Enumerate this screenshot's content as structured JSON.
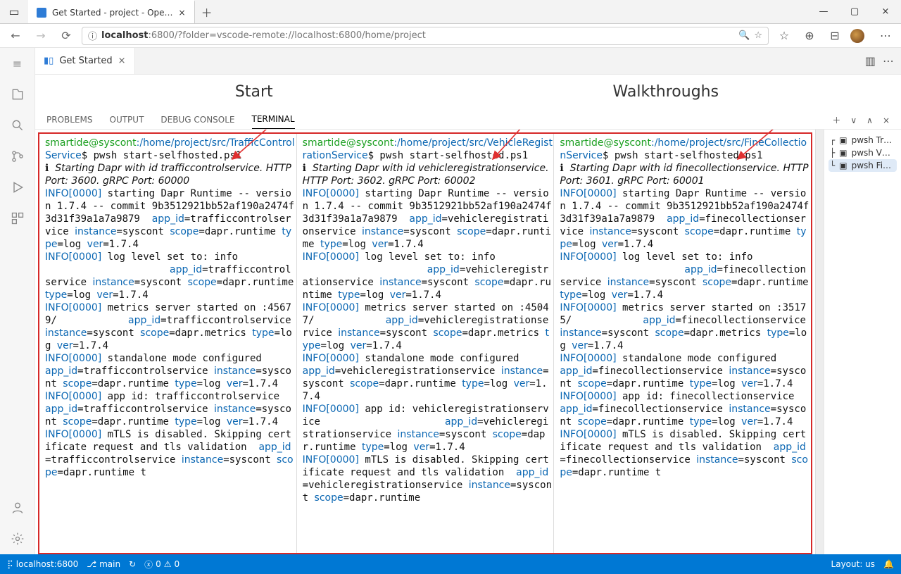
{
  "browser": {
    "tab_title": "Get Started - project - Ope…",
    "url_host": "localhost",
    "url_path": ":6800/?folder=vscode-remote://localhost:6800/home/project"
  },
  "editor": {
    "tab_label": "Get Started"
  },
  "headings": {
    "start": "Start",
    "walkthroughs": "Walkthroughs"
  },
  "panel_tabs": {
    "problems": "PROBLEMS",
    "output": "OUTPUT",
    "debug_console": "DEBUG CONSOLE",
    "terminal": "TERMINAL"
  },
  "terminal_list": [
    "pwsh Tr…",
    "pwsh V…",
    "pwsh Fi…"
  ],
  "status_bar": {
    "remote": "localhost:6800",
    "branch": "main",
    "problems": "0",
    "warnings": "0",
    "layout": "Layout: us"
  },
  "terminal1": {
    "user": "smartide@syscont",
    "path": ":/home/project/src/TrafficControlService",
    "cmd": "$ pwsh start-selfhosted.ps1",
    "line_start": "ℹ  Starting Dapr with id trafficcontrolservice. HTTP Port: 3600. gRPC Port: 60000",
    "runtime": "INFO[0000] starting Dapr Runtime -- version 1.7.4 -- commit 9b3512921bb52af190a2474f3d31f39a1a7a9879  app_id=trafficcontrolservice instance=syscont scope=dapr.runtime type=log ver=1.7.4",
    "loglevel": "INFO[0000] log level set to: info\n                     app_id=trafficcontrolservice instance=syscont scope=dapr.runtime type=log ver=1.7.4",
    "metrics": "INFO[0000] metrics server started on :45679/            app_id=trafficcontrolservice instance=syscont scope=dapr.metrics type=log ver=1.7.4",
    "standalone": "INFO[0000] standalone mode configured                     app_id=trafficcontrolservice instance=syscont scope=dapr.runtime type=log ver=1.7.4",
    "appid": "INFO[0000] app id: trafficcontrolservice                     app_id=trafficcontrolservice instance=syscont scope=dapr.runtime type=log ver=1.7.4",
    "mtls": "INFO[0000] mTLS is disabled. Skipping certificate request and tls validation  app_id=trafficcontrolservice instance=syscont scope=dapr.runtime t"
  },
  "terminal2": {
    "user": "smartide@syscont",
    "path": ":/home/project/src/VehicleRegistrationService",
    "cmd": "$ pwsh start-selfhosted.ps1",
    "line_start": "ℹ  Starting Dapr with id vehicleregistrationservice. HTTP Port: 3602. gRPC Port: 60002",
    "runtime": "INFO[0000] starting Dapr Runtime -- version 1.7.4 -- commit 9b3512921bb52af190a2474f3d31f39a1a7a9879  app_id=vehicleregistrationservice instance=syscont scope=dapr.runtime type=log ver=1.7.4",
    "loglevel": "INFO[0000] log level set to: info\n                     app_id=vehicleregistrationservice instance=syscont scope=dapr.runtime type=log ver=1.7.4",
    "metrics": "INFO[0000] metrics server started on :45047/            app_id=vehicleregistrationservice instance=syscont scope=dapr.metrics type=log ver=1.7.4",
    "standalone": "INFO[0000] standalone mode configured                     app_id=vehicleregistrationservice instance=syscont scope=dapr.runtime type=log ver=1.7.4",
    "appid": "INFO[0000] app id: vehicleregistrationservice                     app_id=vehicleregistrationservice instance=syscont scope=dapr.runtime type=log ver=1.7.4",
    "mtls": "INFO[0000] mTLS is disabled. Skipping certificate request and tls validation  app_id=vehicleregistrationservice instance=syscont scope=dapr.runtime"
  },
  "terminal3": {
    "user": "smartide@syscont",
    "path": ":/home/project/src/FineCollectionService",
    "cmd": "$ pwsh start-selfhosted.ps1",
    "line_start": "ℹ  Starting Dapr with id finecollectionservice. HTTP Port: 3601. gRPC Port: 60001",
    "runtime": "INFO[0000] starting Dapr Runtime -- version 1.7.4 -- commit 9b3512921bb52af190a2474f3d31f39a1a7a9879  app_id=finecollectionservice instance=syscont scope=dapr.runtime type=log ver=1.7.4",
    "loglevel": "INFO[0000] log level set to: info\n                     app_id=finecollectionservice instance=syscont scope=dapr.runtime type=log ver=1.7.4",
    "metrics": "INFO[0000] metrics server started on :35175/            app_id=finecollectionservice instance=syscont scope=dapr.metrics type=log ver=1.7.4",
    "standalone": "INFO[0000] standalone mode configured                     app_id=finecollectionservice instance=syscont scope=dapr.runtime type=log ver=1.7.4",
    "appid": "INFO[0000] app id: finecollectionservice                     app_id=finecollectionservice instance=syscont scope=dapr.runtime type=log ver=1.7.4",
    "mtls": "INFO[0000] mTLS is disabled. Skipping certificate request and tls validation  app_id=finecollectionservice instance=syscont scope=dapr.runtime t"
  }
}
